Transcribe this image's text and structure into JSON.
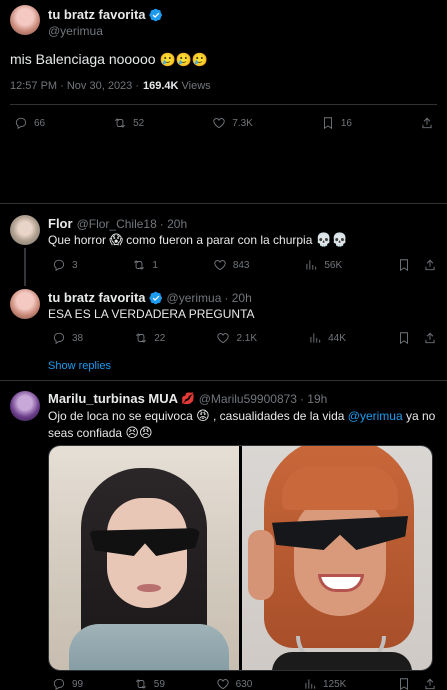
{
  "main_tweet": {
    "display_name": "tu bratz favorita",
    "handle": "@yerimua",
    "text": "mis Balenciaga nooooo",
    "emojis": "🥲🥲🥲",
    "time": "12:57 PM · Nov 30, 2023 ·",
    "views_count": "169.4K",
    "views_label": "Views",
    "replies": "66",
    "retweets": "52",
    "likes": "7.3K",
    "bookmarks": "16"
  },
  "reply1": {
    "display_name": "Flor",
    "handle": "@Flor_Chile18",
    "time": "· 20h",
    "text": "Que horror",
    "emoji1": "😱",
    "text2": "como fueron a parar con la churpia",
    "emoji2": "💀💀",
    "replies": "3",
    "retweets": "1",
    "likes": "843",
    "views": "56K"
  },
  "reply2": {
    "display_name": "tu bratz favorita",
    "handle": "@yerimua",
    "time": "· 20h",
    "text": "ESA ES LA VERDADERA PREGUNTA",
    "replies": "38",
    "retweets": "22",
    "likes": "2.1K",
    "views": "44K"
  },
  "show_replies": "Show replies",
  "reply3": {
    "display_name": "Marilu_turbinas MUA",
    "name_emoji": "💋",
    "handle": "@Marilu59900873",
    "time": "· 19h",
    "text_a": "Ojo de loca no se equivoca",
    "emoji_a": "😡",
    "text_b": ", casualidades de la vida",
    "mention": "@yerimua",
    "text_c": "ya no",
    "text_d": "seas confiada",
    "emoji_b": "😣😠",
    "replies": "99",
    "retweets": "59",
    "likes": "630",
    "views": "125K"
  },
  "colors": {
    "accent": "#1d9bf0",
    "muted": "#71767b",
    "text": "#e7e9ea",
    "bg": "#000000",
    "divider": "#2f3336"
  }
}
